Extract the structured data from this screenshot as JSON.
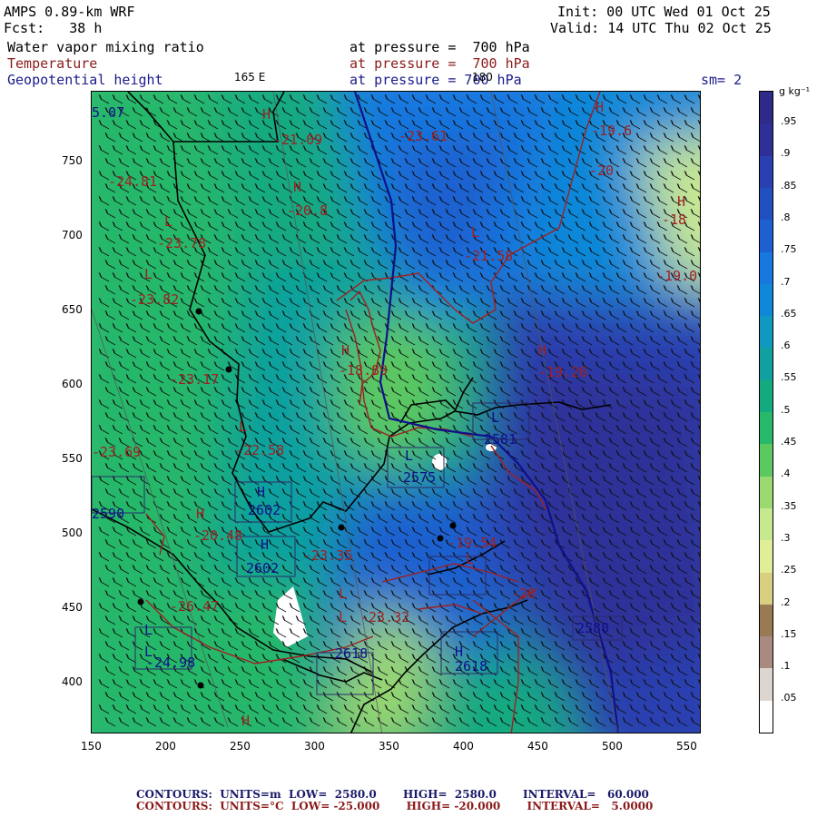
{
  "header": {
    "model": "AMPS 0.89-km WRF",
    "fcst": "Fcst:   38 h",
    "init": "Init: 00 UTC Wed 01 Oct 25",
    "valid": "Valid: 14 UTC Thu 02 Oct 25",
    "field1": "Water vapor mixing ratio",
    "field2": "Temperature",
    "field3": "Geopotential height",
    "level1": "at pressure =  700 hPa",
    "level2": "at pressure =  700 hPa",
    "level3": "at pressure = 700 hPa",
    "lon_165": "165 E",
    "lon_180": "180",
    "smoothing": "sm= 2"
  },
  "colors": {
    "field1": "#000000",
    "field2": "#8b1a1a",
    "field3": "#1a1a8b",
    "temperature_contour": "#a02020",
    "height_contour": "#10108a",
    "coast": "#000000"
  },
  "axes": {
    "x_ticks": [
      "150",
      "200",
      "250",
      "300",
      "350",
      "400",
      "450",
      "500",
      "550"
    ],
    "y_ticks": [
      "750",
      "700",
      "650",
      "600",
      "550",
      "500",
      "450",
      "400"
    ]
  },
  "colorbar": {
    "unit": "g kg⁻¹",
    "labels": [
      ".95",
      ".9",
      ".85",
      ".8",
      ".75",
      ".7",
      ".65",
      ".6",
      ".55",
      ".5",
      ".45",
      ".4",
      ".35",
      ".3",
      ".25",
      ".2",
      ".15",
      ".1",
      ".05"
    ],
    "colors": [
      "#ffffff",
      "#ddd5d0",
      "#a88a80",
      "#9a7a55",
      "#d8d080",
      "#e0ee98",
      "#c6e890",
      "#9ad870",
      "#5cc860",
      "#28b86a",
      "#14aa80",
      "#10a0a0",
      "#1098c0",
      "#1088d8",
      "#1878e0",
      "#1e60d0",
      "#2050c0",
      "#2a40b0",
      "#2e3098",
      "#2e2a88"
    ]
  },
  "map_labels": [
    {
      "t": "5.07",
      "c": "h"
    },
    {
      "t": "H",
      "c": "t"
    },
    {
      "t": "-21.09",
      "c": "t"
    },
    {
      "t": "-23.61",
      "c": "t"
    },
    {
      "t": "H",
      "c": "t"
    },
    {
      "t": "-19.6",
      "c": "t"
    },
    {
      "t": "-20",
      "c": "t"
    },
    {
      "t": "-24.81",
      "c": "t"
    },
    {
      "t": "H",
      "c": "t"
    },
    {
      "t": "-20.8",
      "c": "t"
    },
    {
      "t": "H",
      "c": "t"
    },
    {
      "t": "-18",
      "c": "t"
    },
    {
      "t": "L",
      "c": "t"
    },
    {
      "t": "-23.78",
      "c": "t"
    },
    {
      "t": "L",
      "c": "t"
    },
    {
      "t": "-21.58",
      "c": "t"
    },
    {
      "t": "-19.0",
      "c": "t"
    },
    {
      "t": "L",
      "c": "t"
    },
    {
      "t": "-23.82",
      "c": "t"
    },
    {
      "t": "H",
      "c": "t"
    },
    {
      "t": "-18.89",
      "c": "t"
    },
    {
      "t": "H",
      "c": "t"
    },
    {
      "t": "-19.26",
      "c": "t"
    },
    {
      "t": "-23.17",
      "c": "t"
    },
    {
      "t": "L",
      "c": "t"
    },
    {
      "t": "-22.58",
      "c": "t"
    },
    {
      "t": "-23.69",
      "c": "t"
    },
    {
      "t": "L",
      "c": "h"
    },
    {
      "t": "2575",
      "c": "h"
    },
    {
      "t": "L",
      "c": "h"
    },
    {
      "t": "2581",
      "c": "h"
    },
    {
      "t": "H",
      "c": "h"
    },
    {
      "t": "2602",
      "c": "h"
    },
    {
      "t": "2590",
      "c": "h"
    },
    {
      "t": "H",
      "c": "t"
    },
    {
      "t": "-20.48",
      "c": "t"
    },
    {
      "t": "H",
      "c": "h"
    },
    {
      "t": "2602",
      "c": "h"
    },
    {
      "t": "-23.35",
      "c": "t"
    },
    {
      "t": "-19.54",
      "c": "t"
    },
    {
      "t": "L",
      "c": "t"
    },
    {
      "t": "-20",
      "c": "t"
    },
    {
      "t": "L",
      "c": "t"
    },
    {
      "t": "-26.47",
      "c": "t"
    },
    {
      "t": "L",
      "c": "t"
    },
    {
      "t": "-23.32",
      "c": "t"
    },
    {
      "t": "2580",
      "c": "h"
    },
    {
      "t": "L",
      "c": "h"
    },
    {
      "t": "2618",
      "c": "h"
    },
    {
      "t": "L",
      "c": "h"
    },
    {
      "t": "-24.98",
      "c": "h"
    },
    {
      "t": "H",
      "c": "h"
    },
    {
      "t": "2618",
      "c": "h"
    },
    {
      "t": "H",
      "c": "t"
    }
  ],
  "footer": {
    "line1": "CONTOURS:  UNITS=m  LOW=  2580.0       HIGH=  2580.0       INTERVAL=   60.000",
    "line2": "CONTOURS:  UNITS=°C  LOW= -25.000       HIGH= -20.000       INTERVAL=   5.0000"
  }
}
